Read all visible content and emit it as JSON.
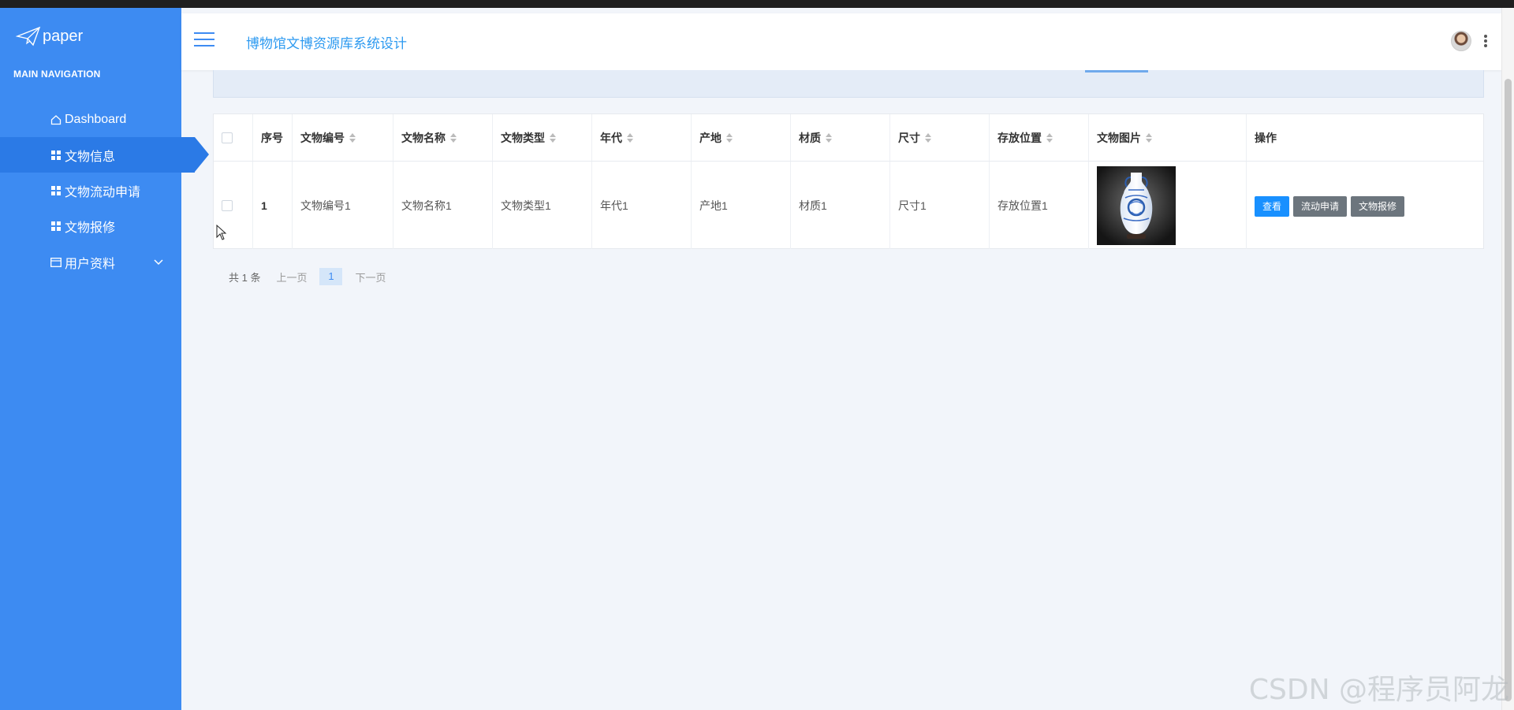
{
  "window": {
    "watermark": "CSDN @程序员阿龙"
  },
  "sidebar": {
    "logo_text": "paper",
    "nav_title": "MAIN NAVIGATION",
    "items": [
      {
        "label": "Dashboard",
        "icon": "home-icon"
      },
      {
        "label": "文物信息",
        "icon": "grid-icon",
        "active": true
      },
      {
        "label": "文物流动申请",
        "icon": "grid-icon"
      },
      {
        "label": "文物报修",
        "icon": "grid-icon"
      },
      {
        "label": "用户资料",
        "icon": "card-icon",
        "expandable": true
      }
    ]
  },
  "header": {
    "title": "博物馆文博资源库系统设计"
  },
  "table": {
    "columns": [
      "序号",
      "文物编号",
      "文物名称",
      "文物类型",
      "年代",
      "产地",
      "材质",
      "尺寸",
      "存放位置",
      "文物图片",
      "操作"
    ],
    "rows": [
      {
        "index": "1",
        "code": "文物编号1",
        "name": "文物名称1",
        "type": "文物类型1",
        "era": "年代1",
        "origin": "产地1",
        "material": "材质1",
        "size": "尺寸1",
        "location": "存放位置1",
        "image": "blue-and-white-porcelain-vase"
      }
    ],
    "actions": {
      "view": "查看",
      "apply": "流动申请",
      "repair": "文物报修"
    }
  },
  "pagination": {
    "total": "共 1 条",
    "prev": "上一页",
    "current": "1",
    "next": "下一页"
  },
  "colors": {
    "sidebar": "#3d8bf2",
    "active": "#2b7ae6",
    "title": "#2d9af0",
    "primary": "#1890ff",
    "gray": "#6c757d"
  }
}
